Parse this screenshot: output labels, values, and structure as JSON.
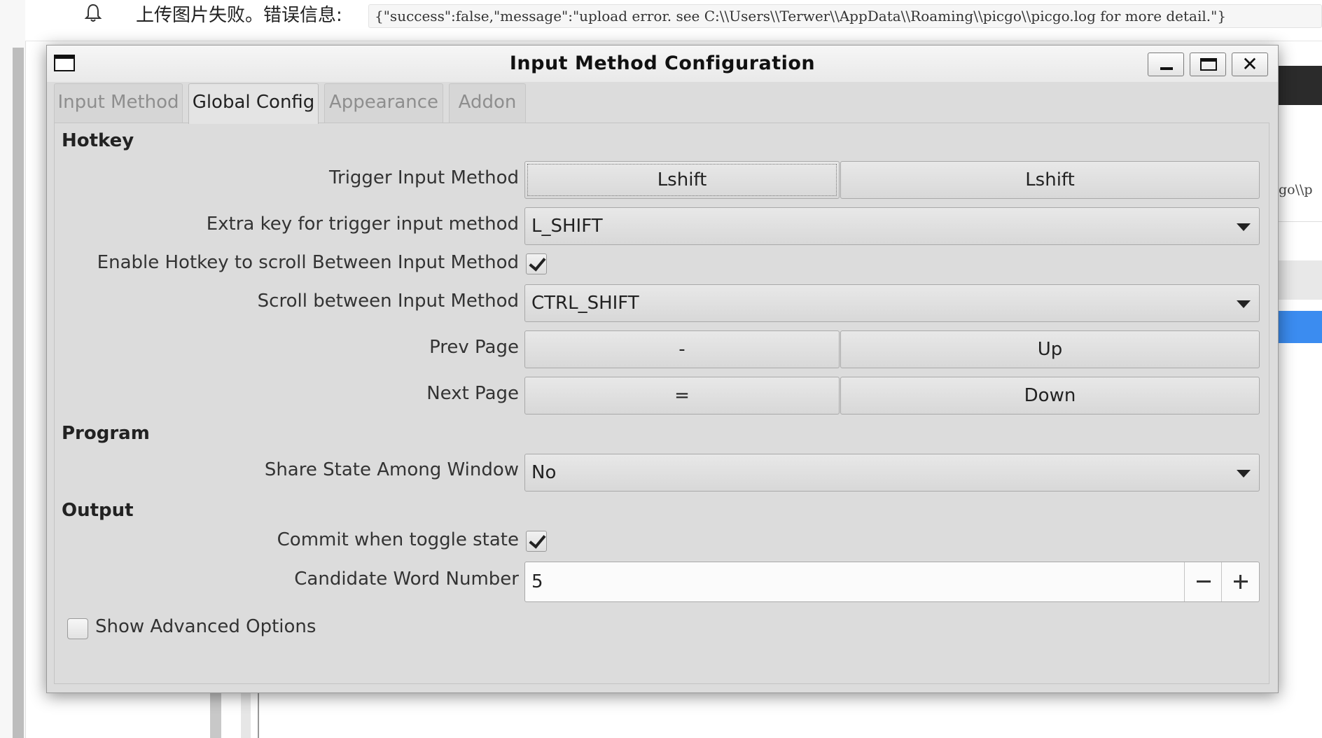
{
  "background": {
    "upload_label": "上传图片失败。错误信息:",
    "upload_message": "{\"success\":false,\"message\":\"upload error. see C:\\\\Users\\\\Terwer\\\\AppData\\\\Roaming\\\\picgo\\\\picgo.log for more detail.\"}",
    "side_path_fragment": "go\\\\p"
  },
  "window": {
    "title": "Input Method Configuration",
    "tabs": [
      {
        "label": "Input Method"
      },
      {
        "label": "Global Config"
      },
      {
        "label": "Appearance"
      },
      {
        "label": "Addon"
      }
    ],
    "active_tab": "Global Config"
  },
  "hotkey": {
    "section_title": "Hotkey",
    "trigger": {
      "label": "Trigger Input Method",
      "key1": "Lshift",
      "key2": "Lshift"
    },
    "extra_key": {
      "label": "Extra key for trigger input method",
      "value": "L_SHIFT"
    },
    "enable_scroll": {
      "label": "Enable Hotkey to scroll Between Input Method",
      "checked": true
    },
    "scroll": {
      "label": "Scroll between Input Method",
      "value": "CTRL_SHIFT"
    },
    "prev_page": {
      "label": "Prev Page",
      "key1": "-",
      "key2": "Up"
    },
    "next_page": {
      "label": "Next Page",
      "key1": "=",
      "key2": "Down"
    }
  },
  "program": {
    "section_title": "Program",
    "share_state": {
      "label": "Share State Among Window",
      "value": "No"
    }
  },
  "output": {
    "section_title": "Output",
    "commit_toggle": {
      "label": "Commit when toggle state",
      "checked": true
    },
    "candidate_number": {
      "label": "Candidate Word Number",
      "value": "5"
    }
  },
  "advanced": {
    "label": "Show Advanced Options",
    "checked": false
  },
  "colors": {
    "accent_blue": "#3b8cf0",
    "window_bg": "#dcdcdc"
  }
}
